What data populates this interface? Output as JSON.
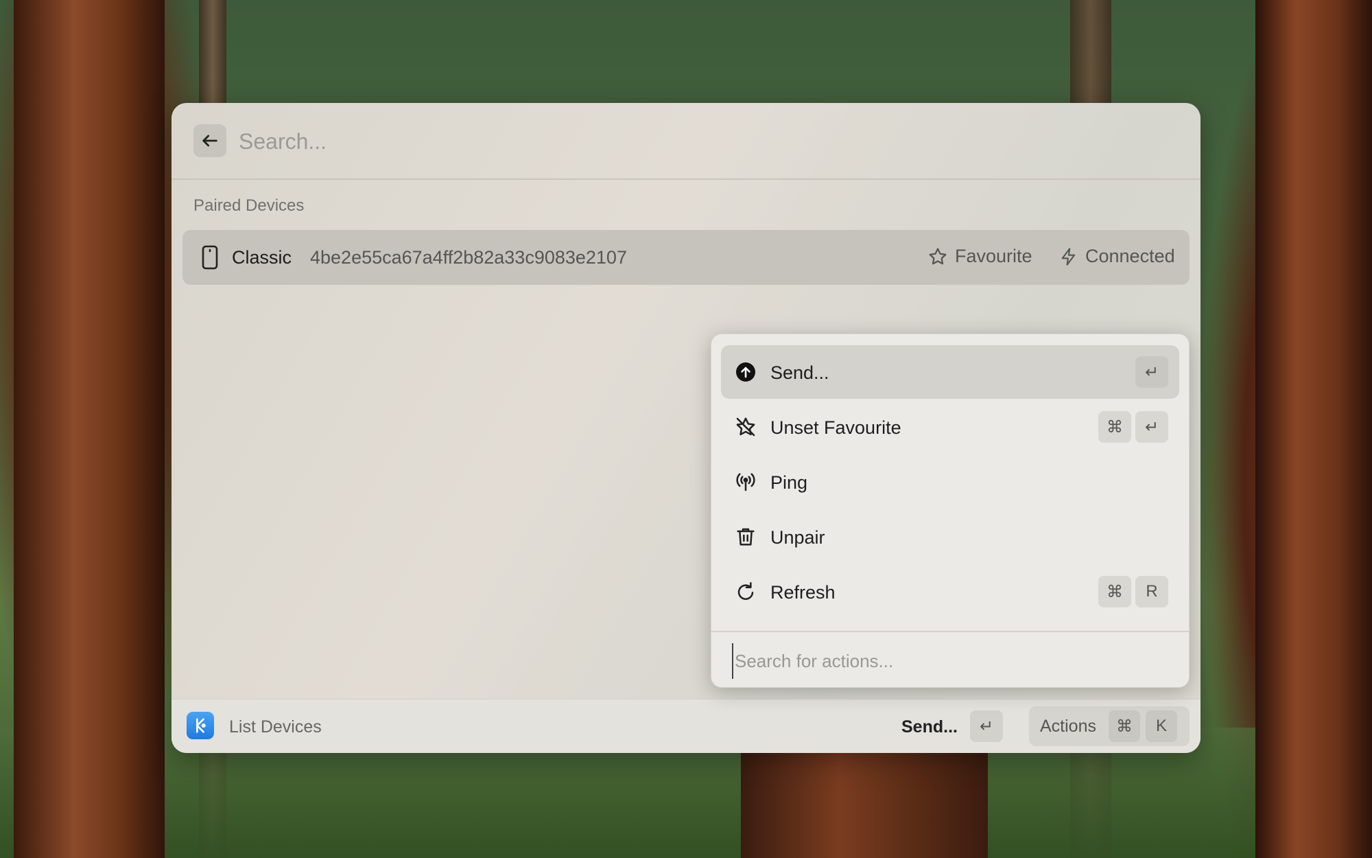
{
  "launcher": {
    "search_placeholder": "Search...",
    "section_title": "Paired Devices",
    "devices": [
      {
        "name": "Classic",
        "id": "4be2e55ca67a4ff2b82a33c9083e2107",
        "accessories": [
          {
            "icon": "star-icon",
            "label": "Favourite"
          },
          {
            "icon": "bolt-icon",
            "label": "Connected"
          }
        ]
      }
    ]
  },
  "action_menu": {
    "items": [
      {
        "icon": "arrow-up-circle-icon",
        "label": "Send...",
        "keys": [
          "↵"
        ],
        "selected": true
      },
      {
        "icon": "star-slash-icon",
        "label": "Unset Favourite",
        "keys": [
          "⌘",
          "↵"
        ]
      },
      {
        "icon": "broadcast-icon",
        "label": "Ping",
        "keys": []
      },
      {
        "icon": "trash-icon",
        "label": "Unpair",
        "keys": []
      },
      {
        "icon": "refresh-icon",
        "label": "Refresh",
        "keys": [
          "⌘",
          "R"
        ]
      }
    ],
    "search_placeholder": "Search for actions..."
  },
  "footer": {
    "app_icon": "kde-connect-icon",
    "title": "List Devices",
    "primary_action": "Send...",
    "primary_key": "↵",
    "actions_label": "Actions",
    "actions_keys": [
      "⌘",
      "K"
    ]
  }
}
